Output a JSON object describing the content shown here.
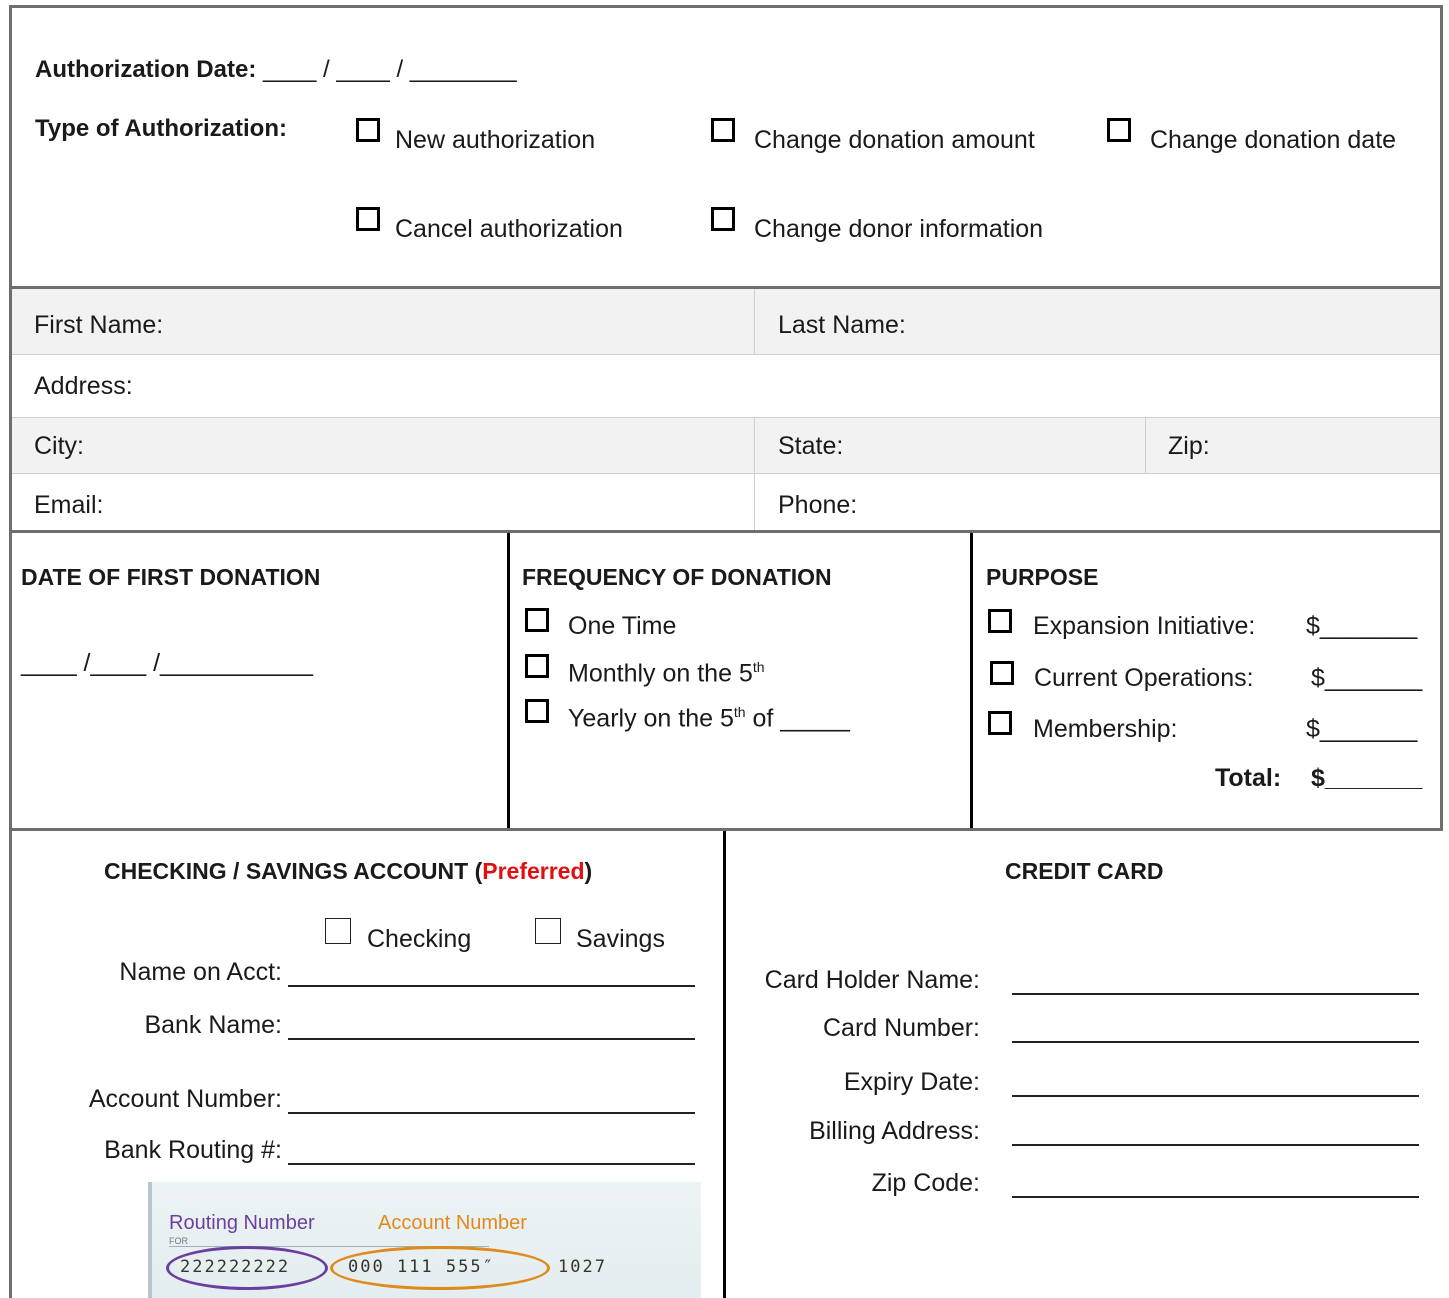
{
  "authorization": {
    "date_label": "Authorization Date:",
    "date_blanks": "____ / ____ / ________",
    "type_label": "Type of Authorization:",
    "options": [
      "New authorization",
      "Change donation amount",
      "Change donation date",
      "Cancel authorization",
      "Change donor information"
    ]
  },
  "donor": {
    "first_name": "First Name:",
    "last_name": "Last Name:",
    "address": "Address:",
    "city": "City:",
    "state": "State:",
    "zip": "Zip:",
    "email": "Email:",
    "phone": "Phone:"
  },
  "first_donation": {
    "heading": "DATE OF FIRST DONATION",
    "blanks": "____ /____ /___________"
  },
  "frequency": {
    "heading": "FREQUENCY OF DONATION",
    "one_time": "One Time",
    "monthly_prefix": "Monthly on the 5",
    "monthly_sup": "th",
    "yearly_prefix": "Yearly on the 5",
    "yearly_sup": "th",
    "yearly_suffix": " of _____"
  },
  "purpose": {
    "heading": "PURPOSE",
    "items": [
      {
        "label": "Expansion Initiative:",
        "amount": "$_______"
      },
      {
        "label": "Current Operations:",
        "amount": "$_______"
      },
      {
        "label": "Membership:",
        "amount": "$_______"
      }
    ],
    "total_label": "Total:",
    "total_amount": "$_______"
  },
  "checking": {
    "heading_prefix": "CHECKING / SAVINGS ACCOUNT (",
    "heading_highlight": "Preferred",
    "heading_suffix": ")",
    "checking_label": "Checking",
    "savings_label": "Savings",
    "fields": [
      "Name on Acct:",
      "Bank Name:",
      "Account Number:",
      "Bank Routing #:"
    ],
    "check_image": {
      "routing_label": "Routing Number",
      "account_label": "Account Number",
      "for_label": "FOR",
      "routing_digits": "222222222",
      "account_digits": "000 111 555″",
      "check_no": "1027"
    }
  },
  "credit_card": {
    "heading": "CREDIT CARD",
    "fields": [
      "Card Holder Name:",
      "Card Number:",
      "Expiry Date:",
      "Billing Address:",
      "Zip Code:"
    ]
  },
  "colors": {
    "accent_red": "#e01010",
    "routing_purple": "#6b3fa0",
    "account_orange": "#e08a1e",
    "row_gray": "#f2f2f2",
    "border_gray": "#6e6e6e"
  }
}
